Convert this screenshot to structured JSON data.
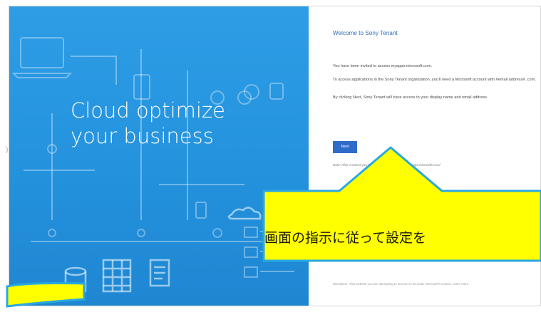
{
  "hero": {
    "line1": "Cloud optimize",
    "line2": "your business"
  },
  "consent": {
    "welcome_title": "Welcome to Sony Tenant",
    "invite_text": "You have been invited to access myapps.microsoft.com.",
    "access_text": "To access applications in the Sony Tenant organization, you'll need a Microsoft account with   #email address#   .com.",
    "consent_text": "By clicking Next, Sony Tenant will have access to your display name and email address.",
    "next_label": "Next",
    "note_text": "Note: After consent you will be redirected to https://myapps.microsoft.com/",
    "footer_text": "Disclaimer: This website you are attempting to access is not under Microsoft's control. Learn more."
  },
  "callout": {
    "text": "画面の指示に従って設定を",
    "fill": "#ffff00",
    "border": "#29a8e0"
  },
  "colors": {
    "panel_blue": "#2492dd",
    "title_blue": "#2a6bb6",
    "button_blue": "#2f6bc9"
  },
  "icons": [
    "laptop-icon",
    "phone-icon",
    "share-icon",
    "pdf-icon",
    "database-icon",
    "table-icon",
    "document-icon",
    "cloud-icon"
  ]
}
